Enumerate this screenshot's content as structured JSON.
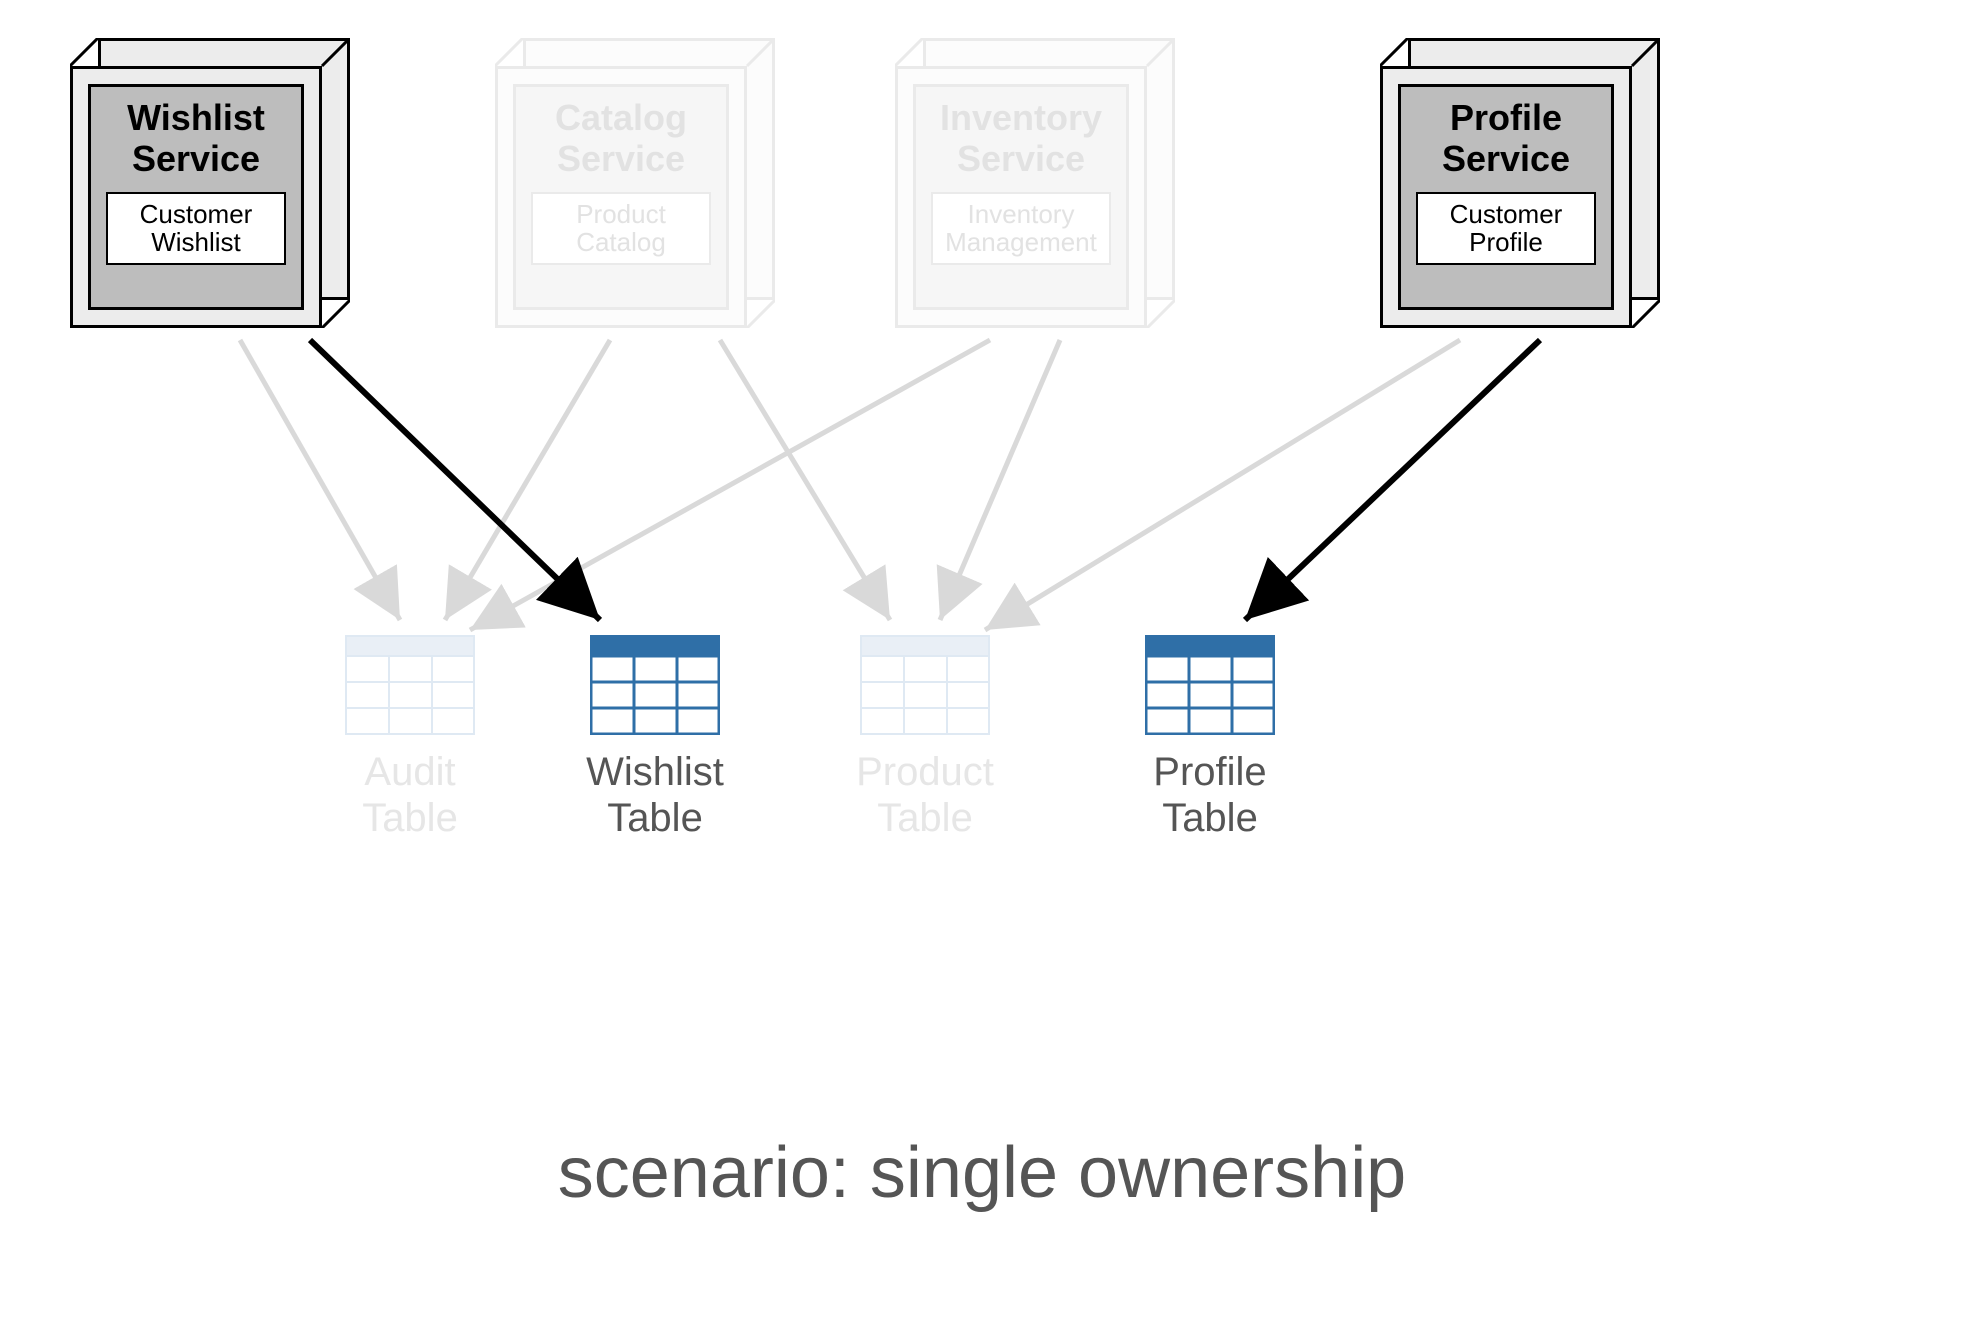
{
  "services": {
    "wishlist": {
      "title": "Wishlist\nService",
      "sub": "Customer\nWishlist"
    },
    "catalog": {
      "title": "Catalog\nService",
      "sub": "Product\nCatalog"
    },
    "inventory": {
      "title": "Inventory\nService",
      "sub": "Inventory\nManagement"
    },
    "profile": {
      "title": "Profile\nService",
      "sub": "Customer\nProfile"
    }
  },
  "tables": {
    "audit": {
      "label": "Audit\nTable"
    },
    "wishlist": {
      "label": "Wishlist\nTable"
    },
    "product": {
      "label": "Product\nTable"
    },
    "profile": {
      "label": "Profile\nTable"
    }
  },
  "caption": "scenario: single ownership",
  "colors": {
    "active_table_header": "#2f6fa7",
    "active_table_border": "#2f6fa7",
    "faded_table": "#dfe9f3",
    "arrow_active": "#000000",
    "arrow_faded": "#d9d9d9"
  }
}
